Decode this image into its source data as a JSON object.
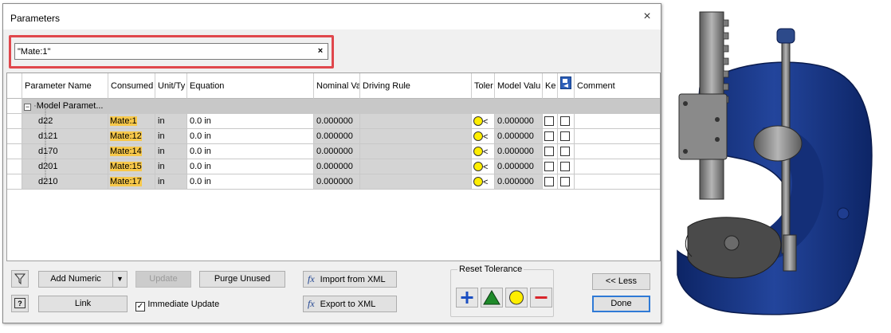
{
  "dialog": {
    "title": "Parameters",
    "close_label": "×"
  },
  "search": {
    "value": "\"Mate:1\"",
    "clear_label": "×"
  },
  "grid": {
    "headers": [
      "Parameter Name",
      "Consumed",
      "Unit/Ty",
      "Equation",
      "Nominal Va",
      "Driving Rule",
      "Toler",
      "Model Valu",
      "Ke",
      "",
      "Comment"
    ],
    "group": {
      "toggle": "−",
      "label": "Model Paramet..."
    },
    "rows": [
      {
        "name": "d22",
        "consumed": "Mate:1",
        "unit": "in",
        "equation": "0.0 in",
        "nominal": "0.000000",
        "tolerance_mark": "<",
        "model_value": "0.000000"
      },
      {
        "name": "d121",
        "consumed": "Mate:12",
        "unit": "in",
        "equation": "0.0 in",
        "nominal": "0.000000",
        "tolerance_mark": "<",
        "model_value": "0.000000"
      },
      {
        "name": "d170",
        "consumed": "Mate:14",
        "unit": "in",
        "equation": "0.0 in",
        "nominal": "0.000000",
        "tolerance_mark": "<",
        "model_value": "0.000000"
      },
      {
        "name": "d201",
        "consumed": "Mate:15",
        "unit": "in",
        "equation": "0.0 in",
        "nominal": "0.000000",
        "tolerance_mark": "<",
        "model_value": "0.000000"
      },
      {
        "name": "d210",
        "consumed": "Mate:17",
        "unit": "in",
        "equation": "0.0 in",
        "nominal": "0.000000",
        "tolerance_mark": "<",
        "model_value": "0.000000"
      }
    ]
  },
  "toolbar": {
    "add_numeric": "Add Numeric",
    "update": "Update",
    "purge_unused": "Purge Unused",
    "import_xml": "Import from XML",
    "export_xml": "Export to XML",
    "link": "Link",
    "immediate_update": "Immediate Update",
    "immediate_update_checked": true,
    "reset_tolerance": "Reset Tolerance",
    "less": "<< Less",
    "done": "Done",
    "fx_symbol": "fx"
  },
  "colors": {
    "highlight_border": "#e0474c",
    "mate_highlight": "#f7c84a",
    "tolerance_plus": "#1b4fc2",
    "tolerance_median": "#1f8a2a",
    "tolerance_nominal": "#ffee00",
    "tolerance_minus": "#d9252b",
    "part_blue": "#1a3a8a"
  },
  "icons": {
    "filter": "funnel-icon",
    "help": "help-icon",
    "fx": "function-icon",
    "export_column": "export-parameter-icon"
  }
}
